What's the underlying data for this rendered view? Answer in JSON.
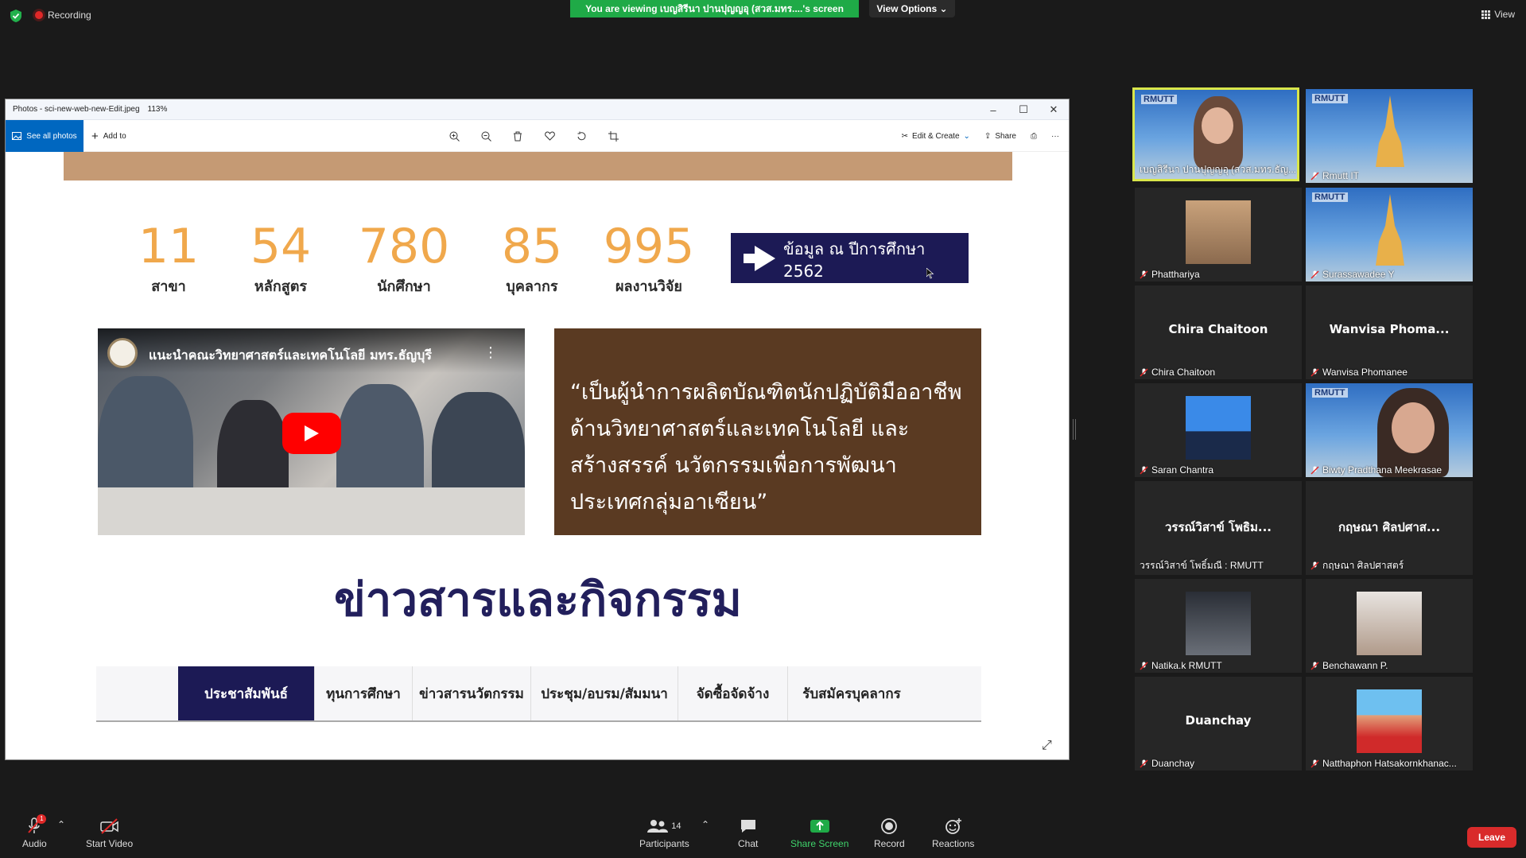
{
  "topbar": {
    "recording_label": "Recording",
    "viewing_banner": "You are viewing เบญสิรีนา ปานปุญญอุ (สวส.มทร....'s screen",
    "view_options_label": "View Options",
    "view_label": "View"
  },
  "photos_window": {
    "title": "Photos - sci-new-web-new-Edit.jpeg",
    "zoom": "113%",
    "see_all_photos": "See all photos",
    "add_to": "Add to",
    "edit_create": "Edit & Create",
    "share": "Share"
  },
  "image": {
    "stats": [
      {
        "num": "11",
        "label": "สาขา"
      },
      {
        "num": "54",
        "label": "หลักสูตร"
      },
      {
        "num": "780",
        "label": "นักศึกษา"
      },
      {
        "num": "85",
        "label": "บุคลากร"
      },
      {
        "num": "995",
        "label": "ผลงานวิจัย"
      }
    ],
    "data_button": "ข้อมูล ณ ปีการศึกษา 2562",
    "video_title": "แนะนำคณะวิทยาศาสตร์และเทคโนโลยี มทร.ธัญบุรี",
    "quote": "“เป็นผู้นำการผลิตบัณฑิตนักปฏิบัติมืออาชีพ ด้านวิทยาศาสตร์และเทคโนโลยี และสร้างสรรค์ นวัตกรรมเพื่อการพัฒนาประเทศกลุ่มอาเซียน”",
    "news_title": "ข่าวสารและกิจกรรม",
    "tabs": [
      "ประชาสัมพันธ์",
      "ทุนการศึกษา",
      "ข่าวสารนวัตกรรม",
      "ประชุม/อบรม/สัมมนา",
      "จัดซื้อจัดจ้าง",
      "รับสมัครบุคลากร"
    ]
  },
  "gallery": {
    "tiles": [
      {
        "name": "เบญสิรีนา ปานปุญญอุ (สวส.มทร.ธัญ...",
        "big": ""
      },
      {
        "name": "Rmutt IT",
        "big": ""
      },
      {
        "name": "Phatthariya",
        "big": ""
      },
      {
        "name": "Surassawadee Y",
        "big": ""
      },
      {
        "name": "Chira Chaitoon",
        "big": "Chira Chaitoon"
      },
      {
        "name": "Wanvisa Phomanee",
        "big": "Wanvisa  Phoma..."
      },
      {
        "name": "Saran Chantra",
        "big": ""
      },
      {
        "name": "Biwty Pradthana Meekrasae",
        "big": ""
      },
      {
        "name": "วรรณ์วิสาข์ โพธิ์มณี : RMUTT",
        "big": "วรรณ์วิสาข์ โพธิม..."
      },
      {
        "name": "กฤษณา ศิลปศาสตร์",
        "big": "กฤษณา ศิลปศาส..."
      },
      {
        "name": "Natika.k RMUTT",
        "big": ""
      },
      {
        "name": "Benchawann P.",
        "big": ""
      },
      {
        "name": "Duanchay",
        "big": "Duanchay"
      },
      {
        "name": "Natthaphon Hatsakornkhanac...",
        "big": ""
      }
    ],
    "rmutt_logo": "RMUTT"
  },
  "bottombar": {
    "audio": "Audio",
    "start_video": "Start Video",
    "participants": "Participants",
    "participants_count": "14",
    "chat": "Chat",
    "share_screen": "Share Screen",
    "record": "Record",
    "reactions": "Reactions",
    "leave": "Leave",
    "audio_badge": "1"
  },
  "colors": {
    "banner_green": "#1faa47",
    "stat_orange": "#f0a84c",
    "navy": "#1c1a55",
    "quote_brown": "#5a3a22",
    "leave_red": "#d92b2b"
  }
}
